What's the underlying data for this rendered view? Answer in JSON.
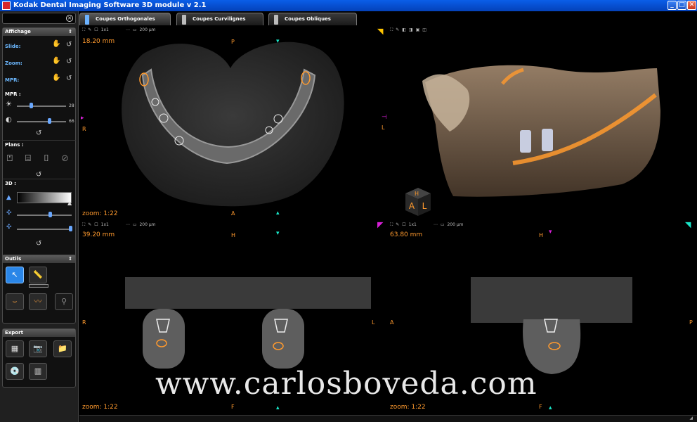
{
  "window": {
    "title": "Kodak Dental Imaging Software 3D module v 2.1"
  },
  "tabs": [
    {
      "label": "Coupes Orthogonales"
    },
    {
      "label": "Coupes Curvilignes"
    },
    {
      "label": "Coupes Obliques"
    }
  ],
  "sidebar": {
    "affichage": {
      "header": "Affichage",
      "slide": "Slide:",
      "zoom": "Zoom:",
      "mpr": "MPR:"
    },
    "mpr": {
      "header": "MPR :",
      "brightness_value": "28",
      "contrast_value": "66",
      "brightness_level": 0.28,
      "contrast_level": 0.66
    },
    "plans": {
      "header": "Plans :"
    },
    "three_d": {
      "header": "3D :",
      "slider1_level": 0.62,
      "slider2_level": 1.0
    },
    "outils": {
      "header": "Outils"
    },
    "export": {
      "header": "Export"
    }
  },
  "viewports": {
    "axial": {
      "thickness": "18.20 mm",
      "zoom": "zoom: 1:22",
      "top": "P",
      "left": "R",
      "right": "L",
      "bottom": "A",
      "slab": "1x1",
      "scale": "200 µm"
    },
    "volume": {},
    "coronal": {
      "thickness": "39.20 mm",
      "zoom": "zoom: 1:22",
      "top": "H",
      "left": "R",
      "right": "L",
      "bottom": "F",
      "slab": "1x1",
      "scale": "200 µm"
    },
    "sagittal": {
      "thickness": "63.80 mm",
      "zoom": "zoom: 1:22",
      "top": "H",
      "left": "A",
      "right": "P",
      "bottom": "F",
      "slab": "1x1",
      "scale": "200 µm"
    }
  },
  "cube": {
    "face1": "H",
    "face2": "A",
    "face3": "L"
  },
  "watermark": "www.carlosboveda.com",
  "colors": {
    "accent": "#ff9a2e",
    "cyan": "#19e6c8",
    "magenta": "#d81fd8",
    "yellow": "#ffc400",
    "selection": "#2a86e8"
  }
}
